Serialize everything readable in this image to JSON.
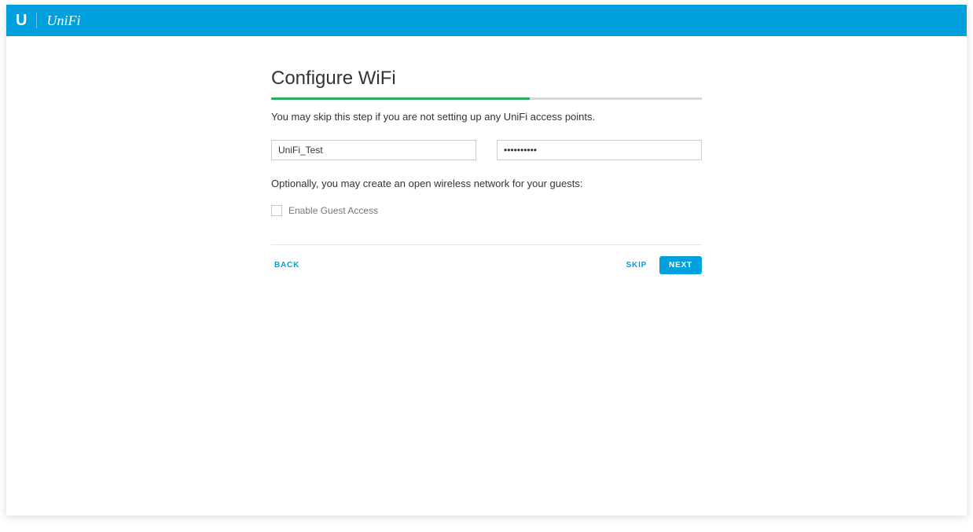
{
  "brand": {
    "short": "U",
    "name": "UniFi"
  },
  "wizard": {
    "title": "Configure WiFi",
    "progress_percent": 60,
    "description": "You may skip this step if you are not setting up any UniFi access points.",
    "ssid_value": "UniFi_Test",
    "password_value": "••••••••••",
    "guest_hint": "Optionally, you may create an open wireless network for your guests:",
    "guest_checkbox_label": "Enable Guest Access",
    "guest_checkbox_checked": false
  },
  "footer": {
    "back_label": "BACK",
    "skip_label": "SKIP",
    "next_label": "NEXT"
  },
  "colors": {
    "brand_blue": "#00a0df",
    "progress_green": "#27ae60"
  }
}
